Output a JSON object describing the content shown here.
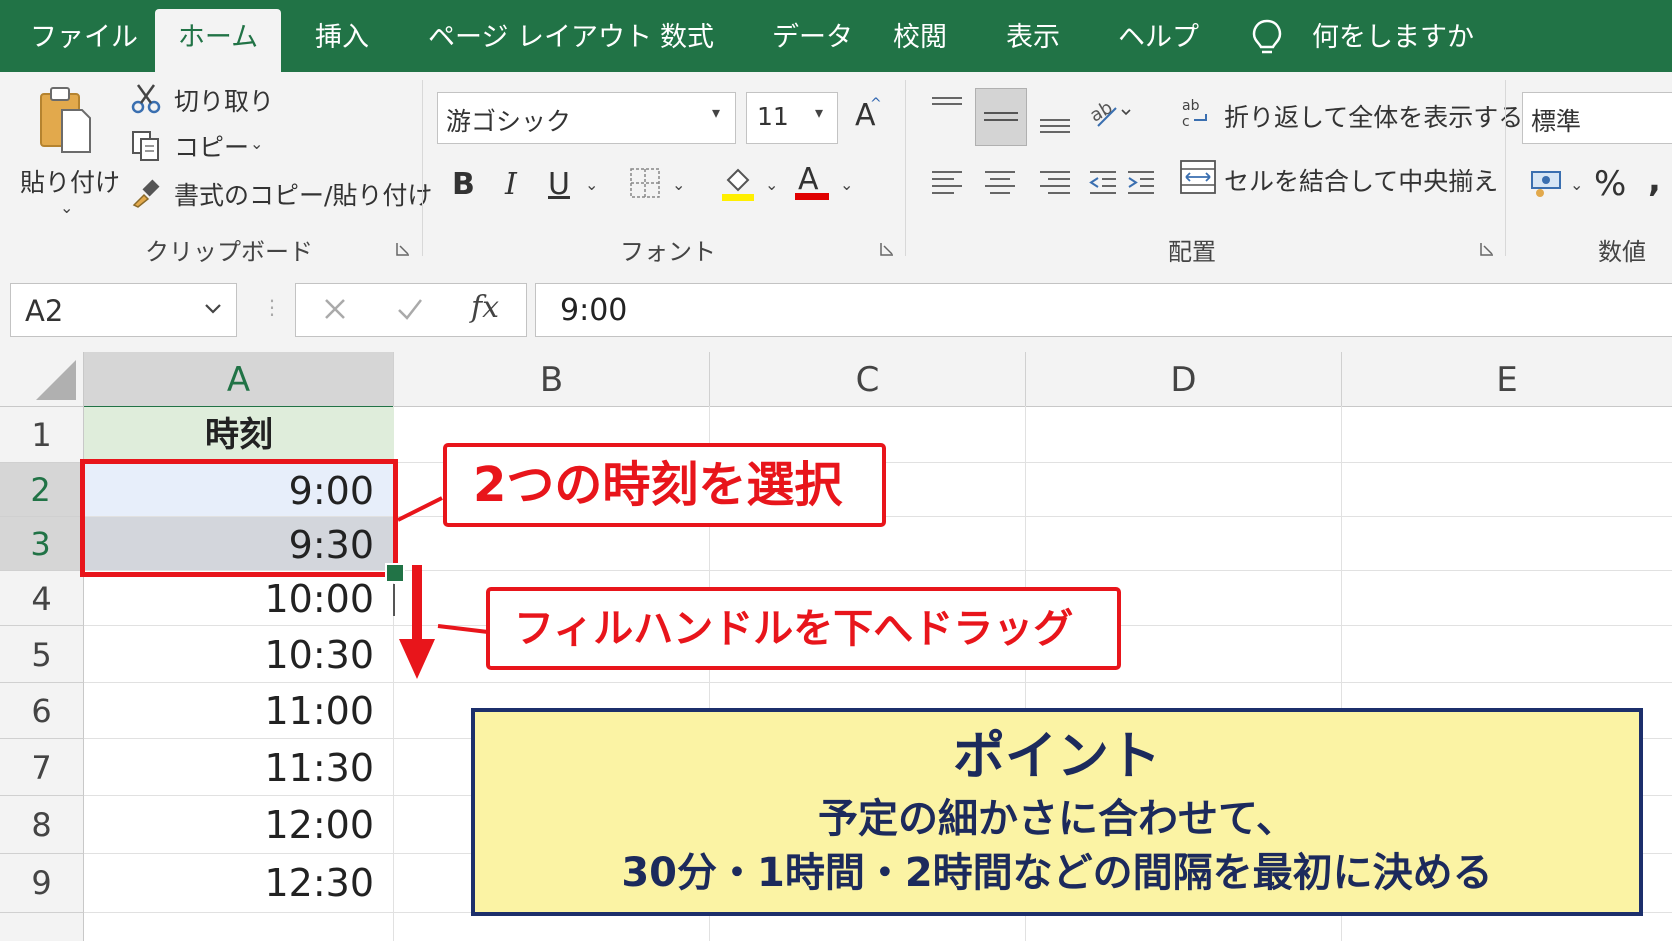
{
  "tabs": [
    "ファイル",
    "ホーム",
    "挿入",
    "ページ レイアウト",
    "数式",
    "データ",
    "校閲",
    "表示",
    "ヘルプ"
  ],
  "active_tab": "ホーム",
  "tell_me": "何をしますか",
  "clipboard": {
    "paste": "貼り付け",
    "cut": "切り取り",
    "copy": "コピー",
    "format_painter": "書式のコピー/貼り付け",
    "group": "クリップボード"
  },
  "font": {
    "name": "游ゴシック",
    "size": "11",
    "grow": "A",
    "bold": "B",
    "italic": "I",
    "underline": "U",
    "color_letter": "A",
    "highlight_color": "#ffef00",
    "font_color": "#e00000",
    "group": "フォント"
  },
  "alignment": {
    "wrap": "折り返して全体を表示する",
    "merge": "セルを結合して中央揃え",
    "group": "配置"
  },
  "number": {
    "format": "標準",
    "percent": "%",
    "comma": ",",
    "group": "数値"
  },
  "formula_bar": {
    "name_box": "A2",
    "fx": "fx",
    "value": "9:00"
  },
  "grid": {
    "columns": [
      "A",
      "B",
      "C",
      "D",
      "E"
    ],
    "rows": [
      "1",
      "2",
      "3",
      "4",
      "5",
      "6",
      "7",
      "8",
      "9"
    ],
    "header_cell": "時刻",
    "times": [
      "9:00",
      "9:30",
      "10:00",
      "10:30",
      "11:00",
      "11:30",
      "12:00",
      "12:30"
    ]
  },
  "annotations": {
    "select_label": "2つの時刻を選択",
    "drag_label": "フィルハンドルを下へドラッグ",
    "point_title": "ポイント",
    "point_line1": "予定の細かさに合わせて、",
    "point_line2": "30分・1時間・2時間などの間隔を最初に決める"
  },
  "colors": {
    "excel_green": "#217346",
    "annotation_red": "#e8151b",
    "point_bg": "#fbf3a4",
    "point_border": "#1c2f6b"
  }
}
